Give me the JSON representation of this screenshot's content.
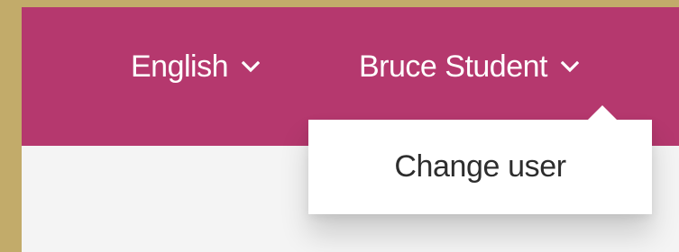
{
  "header": {
    "language_label": "English",
    "user_label": "Bruce Student"
  },
  "user_menu": {
    "items": [
      {
        "label": "Change user"
      }
    ]
  },
  "colors": {
    "header_bg": "#b5386e",
    "page_bg": "#f4f4f4",
    "outer_border": "#c2ab6a",
    "menu_bg": "#ffffff",
    "menu_text": "#2d2d2d",
    "header_text": "#ffffff"
  },
  "icons": {
    "language_chevron": "chevron-down-icon",
    "user_chevron": "chevron-down-icon"
  }
}
